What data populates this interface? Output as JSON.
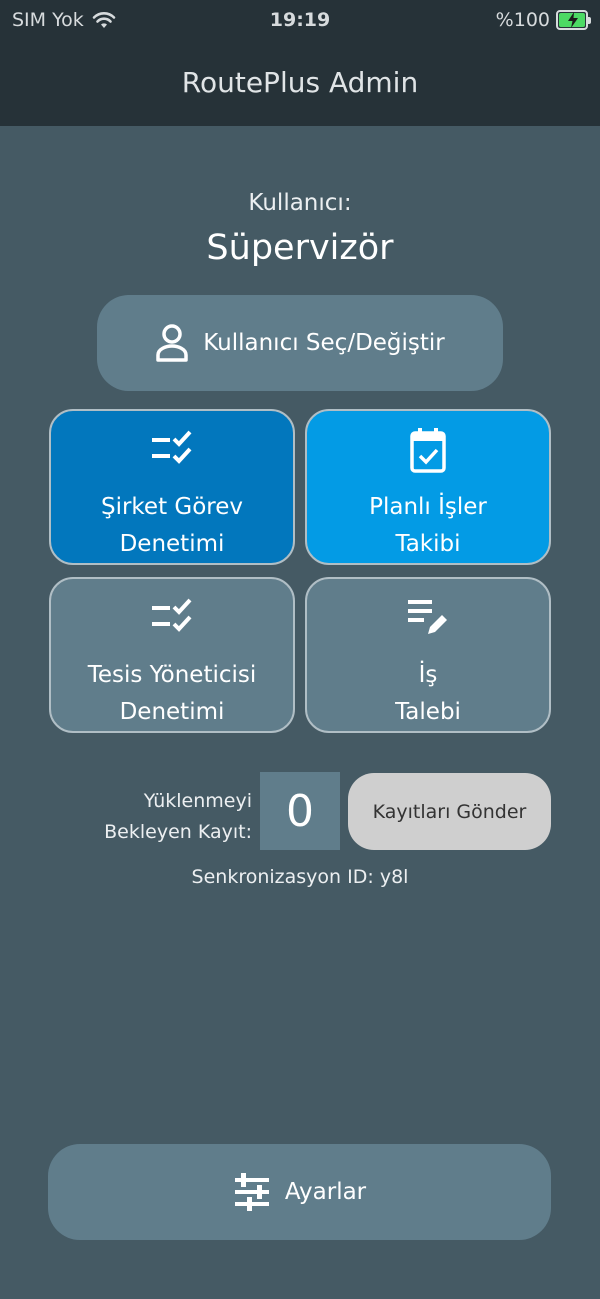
{
  "status_bar": {
    "carrier": "SIM Yok",
    "time": "19:19",
    "battery": "%100"
  },
  "app": {
    "title": "RoutePlus Admin"
  },
  "user": {
    "label": "Kullanıcı:",
    "name": "Süpervizör",
    "select_button": "Kullanıcı Seç/Değiştir"
  },
  "tiles": [
    {
      "line1": "Şirket Görev",
      "line2": "Denetimi",
      "icon": "checklist-icon",
      "color": "#0277bd"
    },
    {
      "line1": "Planlı İşler",
      "line2": "Takibi",
      "icon": "calendar-check-icon",
      "color": "#039be5"
    },
    {
      "line1": "Tesis Yöneticisi",
      "line2": "Denetimi",
      "icon": "checklist-icon",
      "color": "#607d8b"
    },
    {
      "line1": "İş",
      "line2": "Talebi",
      "icon": "edit-note-icon",
      "color": "#607d8b"
    }
  ],
  "pending": {
    "label_line1": "Yüklenmeyi",
    "label_line2": "Bekleyen Kayıt:",
    "count": "0",
    "send_button": "Kayıtları Gönder"
  },
  "sync": {
    "label": "Senkronizasyon ID:",
    "id": "y8l"
  },
  "settings": {
    "label": "Ayarlar"
  },
  "colors": {
    "header_bg": "#263238",
    "page_bg": "#455a64",
    "button_bg": "#607d8b",
    "primary_dark": "#0277bd",
    "primary_light": "#039be5"
  }
}
